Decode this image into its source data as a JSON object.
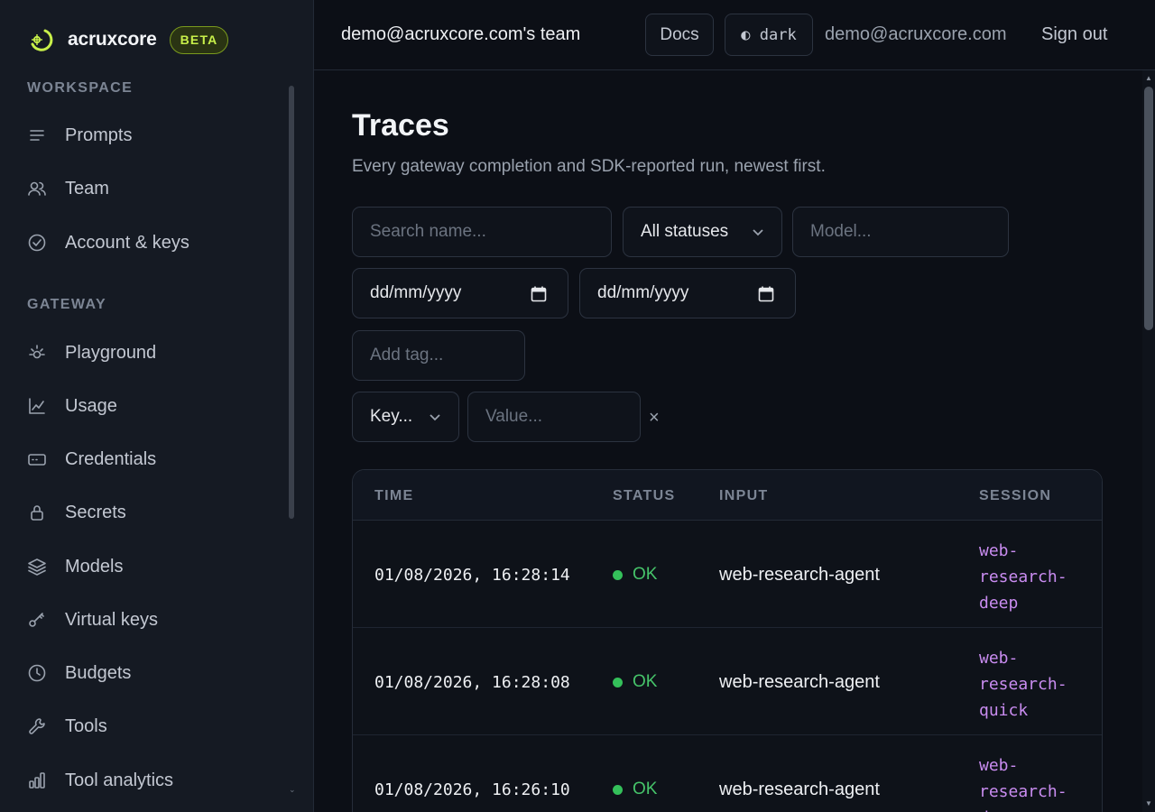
{
  "brand": {
    "name": "acruxcore",
    "badge": "BETA"
  },
  "sidebar": {
    "sections": [
      {
        "label": "WORKSPACE",
        "items": [
          {
            "label": "Prompts",
            "icon": "list-icon"
          },
          {
            "label": "Team",
            "icon": "users-icon"
          },
          {
            "label": "Account & keys",
            "icon": "check-circle-icon"
          }
        ]
      },
      {
        "label": "GATEWAY",
        "items": [
          {
            "label": "Playground",
            "icon": "sun-icon"
          },
          {
            "label": "Usage",
            "icon": "line-chart-icon"
          },
          {
            "label": "Credentials",
            "icon": "card-icon"
          },
          {
            "label": "Secrets",
            "icon": "lock-icon"
          },
          {
            "label": "Models",
            "icon": "layers-icon"
          },
          {
            "label": "Virtual keys",
            "icon": "key-icon"
          },
          {
            "label": "Budgets",
            "icon": "clock-icon"
          },
          {
            "label": "Tools",
            "icon": "wrench-icon"
          },
          {
            "label": "Tool analytics",
            "icon": "bar-chart-icon"
          }
        ]
      }
    ]
  },
  "header": {
    "team": "demo@acruxcore.com's team",
    "docs": "Docs",
    "theme": "◐ dark",
    "email": "demo@acruxcore.com",
    "signout": "Sign out"
  },
  "page": {
    "title": "Traces",
    "subtitle": "Every gateway completion and SDK-reported run, newest first."
  },
  "filters": {
    "search_placeholder": "Search name...",
    "status": "All statuses",
    "model_placeholder": "Model...",
    "date_from": "dd/mm/yyyy",
    "date_to": "dd/mm/yyyy",
    "tag_placeholder": "Add tag...",
    "key": "Key...",
    "value_placeholder": "Value...",
    "clear": "×"
  },
  "table": {
    "columns": [
      "TIME",
      "STATUS",
      "INPUT",
      "SESSION"
    ],
    "rows": [
      {
        "time": "01/08/2026, 16:28:14",
        "status": "OK",
        "input": "web-research-agent",
        "session": [
          "web-",
          "research-",
          "deep"
        ]
      },
      {
        "time": "01/08/2026, 16:28:08",
        "status": "OK",
        "input": "web-research-agent",
        "session": [
          "web-",
          "research-",
          "quick"
        ]
      },
      {
        "time": "01/08/2026, 16:26:10",
        "status": "OK",
        "input": "web-research-agent",
        "session": [
          "web-",
          "research-",
          "deep"
        ]
      }
    ]
  },
  "colors": {
    "accent": "#c8f04a",
    "ok": "#34c05a",
    "session": "#c98cf0",
    "background": "#0c0f16",
    "sidebar": "#151a23"
  }
}
